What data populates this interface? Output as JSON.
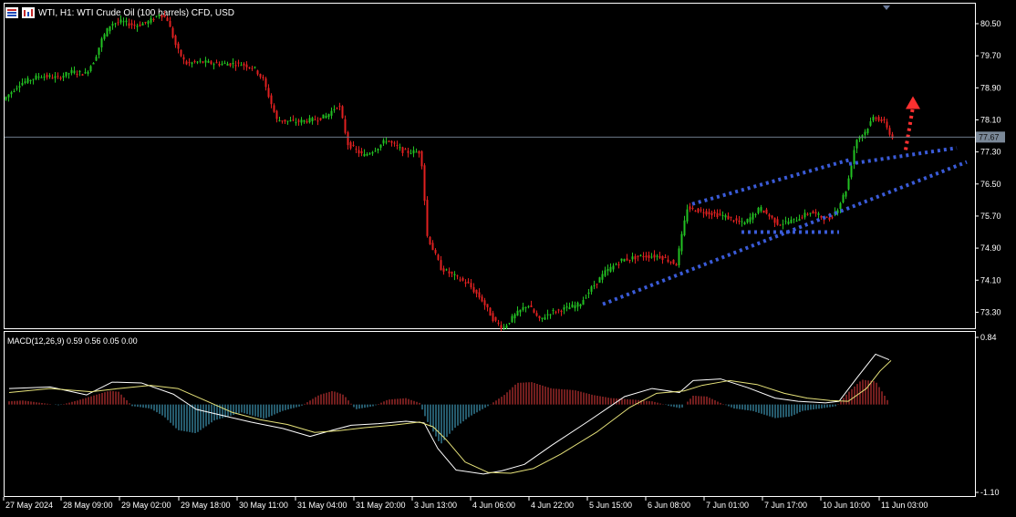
{
  "header": {
    "symbol_title": "WTI, H1:  WTI Crude Oil (100 barrels) CFD, USD",
    "icons": [
      "symbol-list-icon",
      "chart-bars-icon"
    ]
  },
  "price_panel": {
    "current_price_label": "77.67",
    "y_ticks": [
      "80.50",
      "79.70",
      "78.90",
      "78.10",
      "77.30",
      "76.50",
      "75.70",
      "74.90",
      "74.10",
      "73.30"
    ]
  },
  "macd_panel": {
    "title": "MACD(12,26,9) 0.59 0.56 0.05 0.00",
    "y_ticks": [
      "0.84",
      "-1.10"
    ]
  },
  "x_axis": {
    "tick_labels": [
      "27 May 2024",
      "28 May 09:00",
      "29 May 02:00",
      "29 May 18:00",
      "30 May 11:00",
      "31 May 04:00",
      "31 May 20:00",
      "3 Jun 13:00",
      "4 Jun 06:00",
      "4 Jun 22:00",
      "5 Jun 15:00",
      "6 Jun 08:00",
      "7 Jun 01:00",
      "7 Jun 17:00",
      "10 Jun 10:00",
      "11 Jun 03:00"
    ]
  },
  "colors": {
    "background": "#000000",
    "bull_candle": "#22c122",
    "bear_candle": "#e02020",
    "macd_hist_up": "#e53b3b",
    "macd_hist_down": "#4ab4d8",
    "macd_line": "#ffffff",
    "signal_line": "#e6e27a",
    "trendlines": "#3a5bd8",
    "arrow": "#ff3030",
    "axis": "#ffffff"
  },
  "chart_data": [
    {
      "type": "candlestick",
      "ylim": [
        72.9,
        81.0
      ],
      "current_price": 77.67,
      "series": [
        {
          "name": "",
          "path": [
            [
              0,
              78.6
            ],
            [
              18,
              79.0
            ],
            [
              40,
              79.2
            ],
            [
              60,
              79.15
            ],
            [
              75,
              79.3
            ],
            [
              90,
              79.25
            ],
            [
              100,
              79.6
            ],
            [
              108,
              80.1
            ],
            [
              118,
              80.5
            ],
            [
              130,
              80.55
            ],
            [
              145,
              80.45
            ],
            [
              160,
              80.55
            ],
            [
              172,
              80.75
            ],
            [
              180,
              80.6
            ],
            [
              190,
              79.9
            ],
            [
              200,
              79.5
            ],
            [
              215,
              79.55
            ],
            [
              235,
              79.5
            ],
            [
              260,
              79.5
            ],
            [
              275,
              79.4
            ],
            [
              285,
              79.1
            ],
            [
              300,
              78.1
            ],
            [
              320,
              78.05
            ],
            [
              340,
              78.1
            ],
            [
              355,
              78.2
            ],
            [
              368,
              78.5
            ],
            [
              378,
              77.5
            ],
            [
              395,
              77.2
            ],
            [
              410,
              77.4
            ],
            [
              420,
              77.6
            ],
            [
              440,
              77.3
            ],
            [
              458,
              77.3
            ],
            [
              465,
              75.2
            ],
            [
              480,
              74.4
            ],
            [
              495,
              74.2
            ],
            [
              510,
              74.0
            ],
            [
              525,
              73.6
            ],
            [
              538,
              73.1
            ],
            [
              548,
              72.9
            ],
            [
              560,
              73.2
            ],
            [
              575,
              73.5
            ],
            [
              588,
              73.1
            ],
            [
              600,
              73.3
            ],
            [
              618,
              73.4
            ],
            [
              632,
              73.5
            ],
            [
              645,
              73.9
            ],
            [
              660,
              74.3
            ],
            [
              678,
              74.6
            ],
            [
              700,
              74.7
            ],
            [
              720,
              74.7
            ],
            [
              738,
              74.5
            ],
            [
              750,
              75.9
            ],
            [
              770,
              75.8
            ],
            [
              790,
              75.7
            ],
            [
              812,
              75.5
            ],
            [
              830,
              75.9
            ],
            [
              850,
              75.5
            ],
            [
              868,
              75.6
            ],
            [
              885,
              75.8
            ],
            [
              905,
              75.6
            ],
            [
              915,
              75.9
            ],
            [
              925,
              76.4
            ],
            [
              935,
              77.6
            ],
            [
              945,
              77.8
            ],
            [
              955,
              78.2
            ],
            [
              968,
              78.0
            ],
            [
              973,
              77.67
            ]
          ]
        }
      ],
      "annotations": [
        {
          "type": "dotted-line",
          "label": "upper wedge line",
          "points": [
            [
              754,
              76.0
            ],
            [
              926,
              77.1
            ]
          ]
        },
        {
          "type": "dotted-line",
          "label": "upper channel line",
          "points": [
            [
              926,
              77.0
            ],
            [
              1044,
              77.4
            ]
          ]
        },
        {
          "type": "dotted-line",
          "label": "lower channel line",
          "points": [
            [
              656,
              73.5
            ],
            [
              1055,
              77.05
            ]
          ]
        },
        {
          "type": "dotted-line",
          "label": "support line",
          "points": [
            [
              808,
              75.3
            ],
            [
              915,
              75.3
            ]
          ]
        },
        {
          "type": "dotted-arrow",
          "label": "up arrow",
          "points": [
            [
              988,
              77.35
            ],
            [
              996,
              78.6
            ]
          ]
        }
      ]
    },
    {
      "type": "line",
      "title": "MACD(12,26,9) 0.59 0.56 0.05 0.00",
      "ylim": [
        -1.1,
        0.84
      ],
      "histogram": [
        [
          5,
          0.04
        ],
        [
          20,
          0.05
        ],
        [
          40,
          0.02
        ],
        [
          60,
          -0.01
        ],
        [
          80,
          0.05
        ],
        [
          100,
          0.12
        ],
        [
          115,
          0.17
        ],
        [
          125,
          0.16
        ],
        [
          140,
          -0.02
        ],
        [
          160,
          -0.05
        ],
        [
          175,
          -0.15
        ],
        [
          190,
          -0.32
        ],
        [
          210,
          -0.36
        ],
        [
          230,
          -0.2
        ],
        [
          260,
          -0.1
        ],
        [
          285,
          -0.18
        ],
        [
          305,
          -0.08
        ],
        [
          325,
          -0.02
        ],
        [
          345,
          0.12
        ],
        [
          360,
          0.17
        ],
        [
          372,
          0.12
        ],
        [
          385,
          -0.06
        ],
        [
          405,
          -0.02
        ],
        [
          420,
          0.06
        ],
        [
          440,
          0.08
        ],
        [
          455,
          0.02
        ],
        [
          463,
          -0.2
        ],
        [
          478,
          -0.5
        ],
        [
          493,
          -0.3
        ],
        [
          510,
          -0.15
        ],
        [
          530,
          -0.02
        ],
        [
          548,
          0.12
        ],
        [
          562,
          0.27
        ],
        [
          578,
          0.28
        ],
        [
          600,
          0.2
        ],
        [
          625,
          0.18
        ],
        [
          645,
          0.12
        ],
        [
          665,
          0.08
        ],
        [
          690,
          0.06
        ],
        [
          710,
          0.04
        ],
        [
          730,
          -0.02
        ],
        [
          742,
          -0.05
        ],
        [
          755,
          0.11
        ],
        [
          770,
          0.1
        ],
        [
          785,
          0.02
        ],
        [
          800,
          -0.05
        ],
        [
          820,
          -0.08
        ],
        [
          845,
          -0.17
        ],
        [
          862,
          -0.15
        ],
        [
          875,
          -0.08
        ],
        [
          895,
          -0.05
        ],
        [
          912,
          -0.02
        ],
        [
          925,
          0.15
        ],
        [
          940,
          0.31
        ],
        [
          955,
          0.29
        ],
        [
          970,
          0.02
        ]
      ],
      "series": [
        {
          "name": "",
          "x": [
            5,
            50,
            90,
            118,
            150,
            185,
            210,
            240,
            270,
            305,
            335,
            360,
            380,
            410,
            440,
            460,
            475,
            495,
            525,
            545,
            570,
            600,
            640,
            680,
            710,
            740,
            755,
            785,
            815,
            845,
            870,
            900,
            915,
            935,
            955,
            970
          ],
          "y": [
            0.2,
            0.22,
            0.12,
            0.28,
            0.27,
            0.13,
            -0.06,
            -0.14,
            -0.22,
            -0.3,
            -0.4,
            -0.32,
            -0.26,
            -0.24,
            -0.21,
            -0.23,
            -0.55,
            -0.82,
            -0.87,
            -0.83,
            -0.75,
            -0.51,
            -0.21,
            0.1,
            0.2,
            0.15,
            0.3,
            0.32,
            0.21,
            0.08,
            0.04,
            0.02,
            0.04,
            0.34,
            0.63,
            0.56
          ]
        },
        {
          "name": "",
          "x": [
            5,
            50,
            95,
            125,
            160,
            190,
            220,
            250,
            280,
            310,
            340,
            365,
            395,
            425,
            455,
            470,
            485,
            505,
            530,
            555,
            580,
            610,
            650,
            685,
            715,
            745,
            765,
            795,
            825,
            855,
            880,
            905,
            925,
            945,
            960,
            972
          ],
          "y": [
            0.15,
            0.2,
            0.16,
            0.2,
            0.24,
            0.2,
            0.05,
            -0.1,
            -0.19,
            -0.25,
            -0.35,
            -0.33,
            -0.29,
            -0.26,
            -0.22,
            -0.28,
            -0.45,
            -0.72,
            -0.85,
            -0.86,
            -0.8,
            -0.62,
            -0.34,
            -0.04,
            0.14,
            0.17,
            0.24,
            0.3,
            0.25,
            0.14,
            0.08,
            0.05,
            0.04,
            0.2,
            0.42,
            0.55
          ]
        }
      ]
    }
  ]
}
